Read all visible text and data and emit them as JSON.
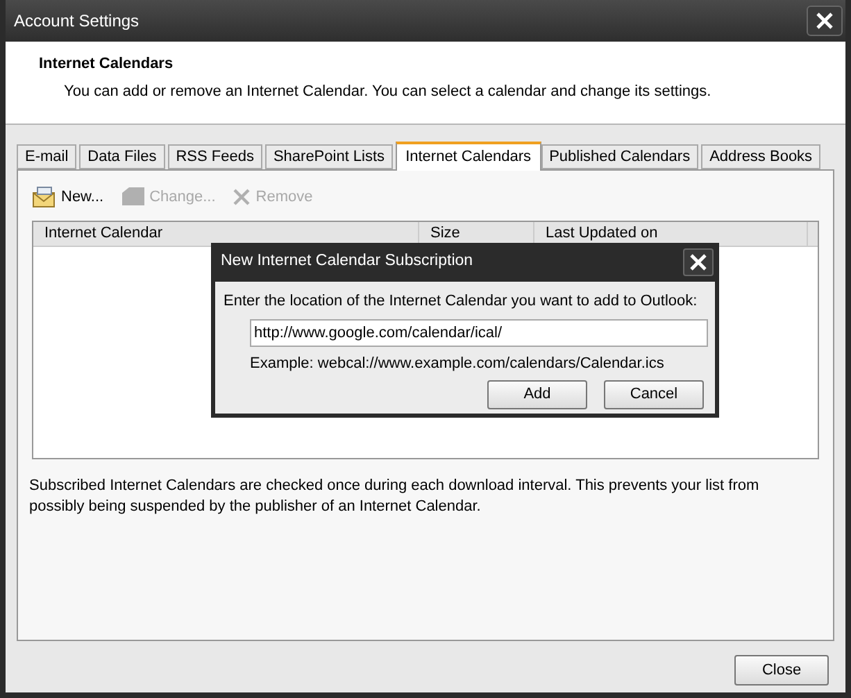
{
  "window": {
    "title": "Account Settings"
  },
  "header": {
    "title": "Internet Calendars",
    "description": "You can add or remove an Internet Calendar. You can select a calendar and change its settings."
  },
  "tabs": [
    {
      "label": "E-mail",
      "selected": false
    },
    {
      "label": "Data Files",
      "selected": false
    },
    {
      "label": "RSS Feeds",
      "selected": false
    },
    {
      "label": "SharePoint Lists",
      "selected": false
    },
    {
      "label": "Internet Calendars",
      "selected": true
    },
    {
      "label": "Published Calendars",
      "selected": false
    },
    {
      "label": "Address Books",
      "selected": false
    }
  ],
  "toolbar": [
    {
      "kind": "new",
      "label": "New...",
      "disabled": false
    },
    {
      "kind": "change",
      "label": "Change...",
      "disabled": true
    },
    {
      "kind": "remove",
      "label": "Remove",
      "disabled": true
    }
  ],
  "table": {
    "columns": [
      "Internet Calendar",
      "Size",
      "Last Updated on"
    ]
  },
  "note": "Subscribed Internet Calendars are checked once during each download interval. This prevents your list from possibly being suspended by the publisher of an Internet Calendar.",
  "dialog": {
    "title": "New Internet Calendar Subscription",
    "prompt": "Enter the location of the Internet Calendar you want to add to Outlook:",
    "value": "http://www.google.com/calendar/ical/",
    "example": "Example: webcal://www.example.com/calendars/Calendar.ics",
    "buttons": [
      "Add",
      "Cancel"
    ]
  },
  "buttons": [
    "Close"
  ]
}
